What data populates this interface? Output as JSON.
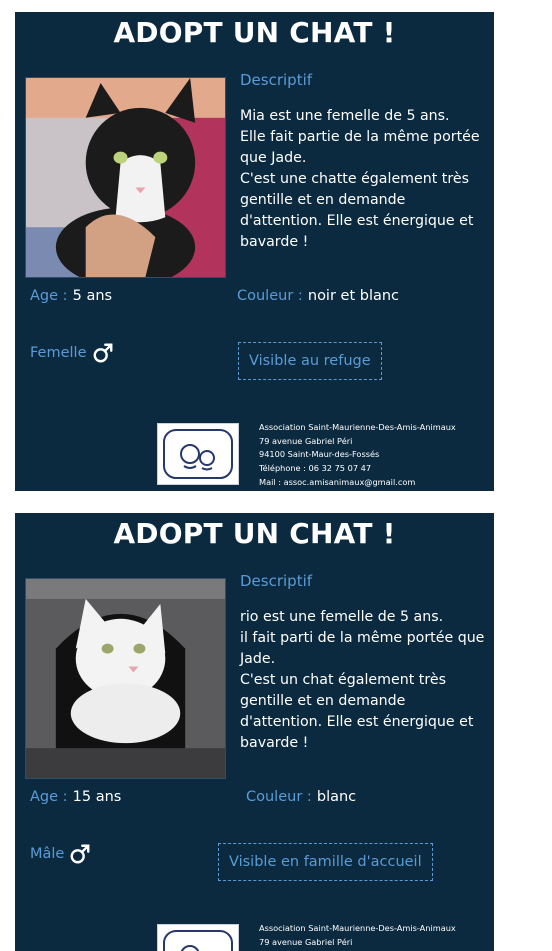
{
  "cards": [
    {
      "title": "ADOPT UN CHAT !",
      "photo_alt": "black-and-white-cat",
      "desc_label": "Descriptif",
      "description": "Mia est une femelle de 5 ans.\nElle fait partie de la même portée que Jade.\nC'est une chatte également très gentille et en demande d'attention. Elle est énergique et bavarde !",
      "age_label": "Age :",
      "age_value": "5 ans",
      "color_label": "Couleur :",
      "color_value": "noir et blanc",
      "sex_label": "Femelle",
      "sex_icon": "male-symbol-icon",
      "status_label": "Visible au refuge"
    },
    {
      "title": "ADOPT UN CHAT !",
      "photo_alt": "white-cat",
      "desc_label": "Descriptif",
      "description": "rio est une femelle de 5 ans.\nil fait parti de la même portée que Jade.\nC'est un chat également très gentille et en demande d'attention. Elle est énergique et bavarde !",
      "age_label": "Age :",
      "age_value": "15 ans",
      "color_label": "Couleur :",
      "color_value": "blanc",
      "sex_label": "Mâle",
      "sex_icon": "male-symbol-icon",
      "status_label": "Visible en famille d'accueil"
    }
  ],
  "association": {
    "name": "Association Saint-Maurienne-Des-Amis-Animaux",
    "address": "79 avenue Gabriel Péri",
    "city": "94100 Saint-Maur-des-Fossés",
    "phone": "Téléphone : 06 32 75 07 47",
    "mail": "Mail : assoc.amisanimaux@gmail.com"
  },
  "colors": {
    "card_bg": "#0b2a40",
    "label_blue": "#5b9bd5",
    "text": "#ffffff"
  }
}
